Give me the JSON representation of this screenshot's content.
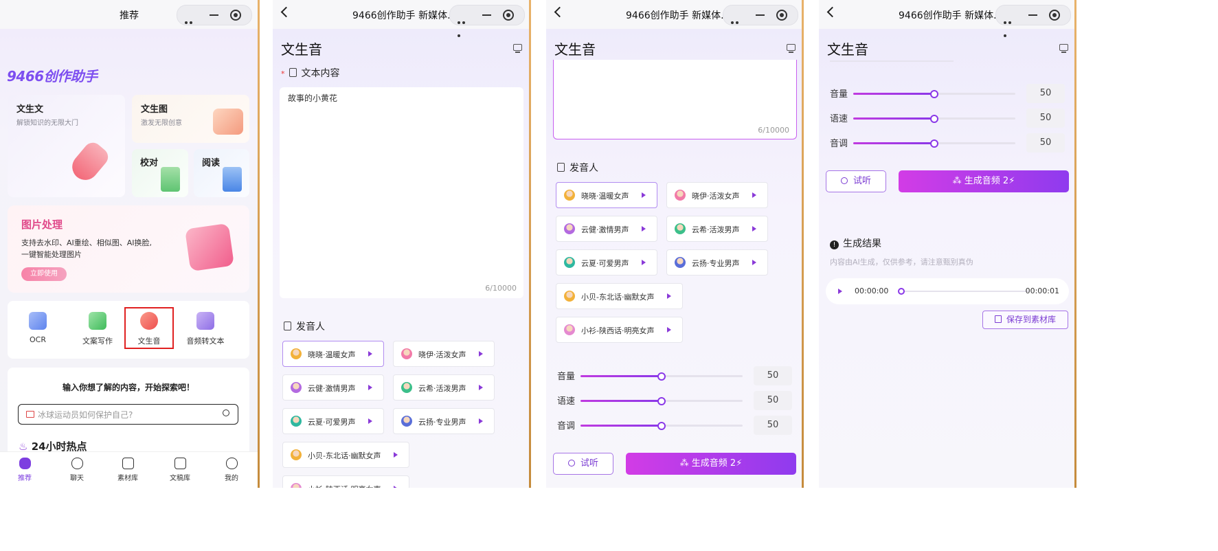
{
  "p1": {
    "title": "推荐",
    "logo": "9466创作助手",
    "cards": {
      "wsw": {
        "title": "文生文",
        "sub": "解锁知识的无限大门"
      },
      "wst": {
        "title": "文生图",
        "sub": "激发无限创意"
      },
      "jd": {
        "title": "校对"
      },
      "yd": {
        "title": "阅读"
      }
    },
    "banner": {
      "title": "图片处理",
      "desc1": "支持去水印、AI重绘、相似图、AI换脸,",
      "desc2": "一键智能处理图片",
      "btn": "立即使用"
    },
    "tools": [
      {
        "label": "OCR",
        "icon": "ocr-icon",
        "color": "#6f8ef0"
      },
      {
        "label": "文案写作",
        "icon": "copywriting-icon",
        "color": "#4cc46a"
      },
      {
        "label": "文生音",
        "icon": "text-to-speech-icon",
        "color": "#f06a58"
      },
      {
        "label": "音频转文本",
        "icon": "audio-to-text-icon",
        "color": "#9a7ae8"
      }
    ],
    "explore_title": "输入你想了解的内容，开始探索吧！",
    "search_placeholder": "冰球运动员如何保护自己?",
    "hot_title": "24小时热点",
    "tabs": [
      "推荐",
      "聊天",
      "素材库",
      "文稿库",
      "我的"
    ]
  },
  "nav_title": "9466创作助手 新媒体...",
  "page_title": "文生音",
  "text_section": "文本内容",
  "text_value": "故事的小黄花",
  "counter": "6/10000",
  "voice_section": "发音人",
  "voices": [
    {
      "label": "晓晓·温暖女声",
      "color": "#f2b13a",
      "selected": true
    },
    {
      "label": "晓伊·活泼女声",
      "color": "#f27aa8",
      "selected": false
    },
    {
      "label": "云健·激情男声",
      "color": "#b36ae0",
      "selected": false
    },
    {
      "label": "云希·活泼男声",
      "color": "#3cbf8a",
      "selected": false
    },
    {
      "label": "云夏·可爱男声",
      "color": "#2fb8a0",
      "selected": false
    },
    {
      "label": "云扬·专业男声",
      "color": "#5a6ed8",
      "selected": false
    },
    {
      "label": "小贝-东北话·幽默女声",
      "color": "#f2b13a",
      "selected": false
    },
    {
      "label": "小衫-陕西话·明亮女声",
      "color": "#e58ad0",
      "selected": false
    }
  ],
  "sliders": [
    {
      "label": "音量",
      "value": "50",
      "fraction": 0.5
    },
    {
      "label": "语速",
      "value": "50",
      "fraction": 0.5
    },
    {
      "label": "音调",
      "value": "50",
      "fraction": 0.5
    }
  ],
  "btn_try": "试听",
  "btn_gen": "生成音频 2⚡",
  "result": {
    "title": "生成结果",
    "disclaimer": "内容由AI生成，仅供参考，请注意甄别真伪",
    "time_start": "00:00:00",
    "time_end": "00:00:01",
    "save_btn": "保存到素材库"
  }
}
